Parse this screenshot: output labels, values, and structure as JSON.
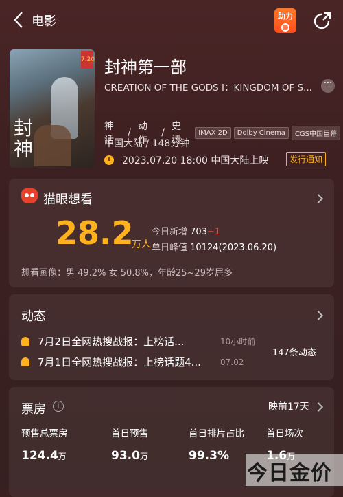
{
  "topbar": {
    "back_label": "电影",
    "boost_label": "助力"
  },
  "movie": {
    "title": "封神第一部",
    "subtitle": "CREATION OF THE GODS I：KINGDOM OF S...",
    "genres": [
      "神话",
      "/",
      "动作",
      "/",
      "史诗"
    ],
    "formats": [
      "IMAX 2D",
      "Dolby Cinema",
      "CGS中国巨幕"
    ],
    "region_runtime": "中国大陆 / 148分钟",
    "release": "2023.07.20 18:00 中国大陆上映",
    "notify_label": "发行通知",
    "poster": {
      "glyph": "封神",
      "badge": "7.20"
    }
  },
  "want": {
    "title": "猫眼想看",
    "number": "28.2",
    "unit": "万人",
    "today_label": "今日新增",
    "today_value": "703",
    "today_delta": "+1",
    "peak_label": "单日峰值",
    "peak_value": "10124",
    "peak_date": "(2023.06.20)",
    "portrait": "想看画像：男 49.2% 女 50.8%，年龄25~29岁居多"
  },
  "news": {
    "title": "动态",
    "items": [
      {
        "text": "7月2日全网热搜战报：上榜话...",
        "time": "10小时前"
      },
      {
        "text": "7月1日全网热搜战报：上榜话题4...",
        "time": "07.02"
      }
    ],
    "count": "147条动态"
  },
  "boxoffice": {
    "title": "票房",
    "pre_label": "映前17天",
    "cols": [
      {
        "label": "预售总票房",
        "value": "124.4",
        "unit": "万"
      },
      {
        "label": "首日预售",
        "value": "93.0",
        "unit": "万"
      },
      {
        "label": "首日排片占比",
        "value": "99.3%",
        "unit": ""
      },
      {
        "label": "首日场次",
        "value": "1.6",
        "unit": "万"
      }
    ]
  },
  "watermark": "今日金价"
}
